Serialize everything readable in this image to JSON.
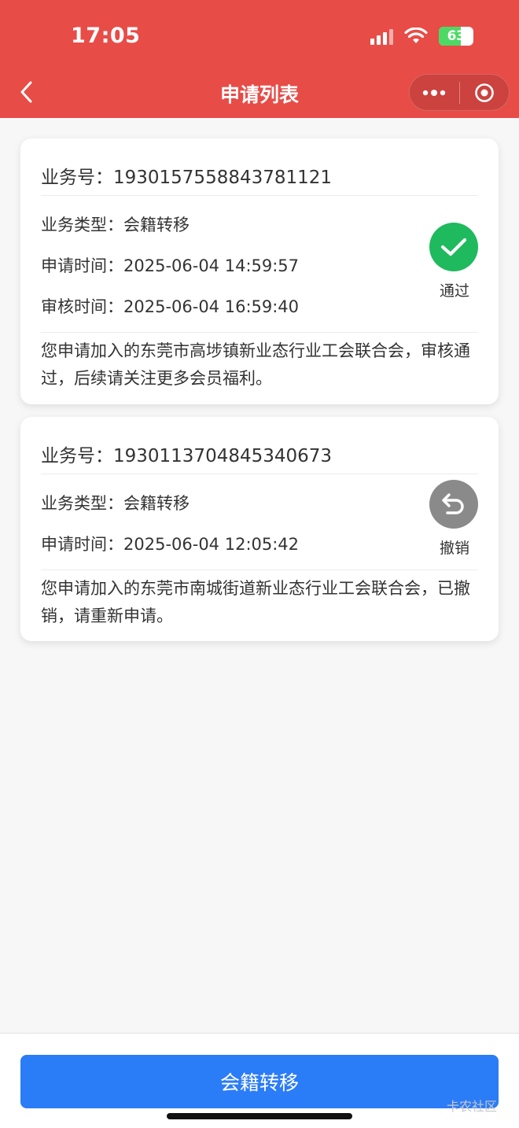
{
  "status_bar": {
    "time": "17:05",
    "battery": "63"
  },
  "nav": {
    "title": "申请列表"
  },
  "applications": [
    {
      "business_no": "业务号：1930157558843781121",
      "type": "业务类型：会籍转移",
      "apply_time": "申请时间：2025-06-04 14:59:57",
      "review_time": "审核时间：2025-06-04 16:59:40",
      "status": "通过",
      "status_color": "#1fba5e",
      "description": "您申请加入的东莞市高埗镇新业态行业工会联合会，审核通过，后续请关注更多会员福利。"
    },
    {
      "business_no": "业务号：1930113704845340673",
      "type": "业务类型：会籍转移",
      "apply_time": "申请时间：2025-06-04 12:05:42",
      "status": "撤销",
      "status_color": "#8a8a8a",
      "description": "您申请加入的东莞市南城街道新业态行业工会联合会，已撤销，请重新申请。"
    }
  ],
  "footer": {
    "button_label": "会籍转移",
    "watermark": "卡农社区"
  },
  "colors": {
    "header": "#e84c47",
    "primary": "#2b7cf7"
  }
}
